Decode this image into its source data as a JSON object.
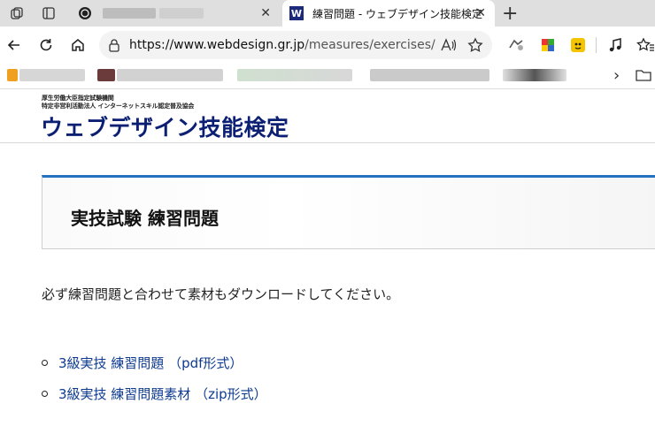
{
  "browser": {
    "tabs": [
      {
        "title": "",
        "active": false
      },
      {
        "title": "練習問題 - ウェブデザイン技能検定",
        "favicon": "W",
        "active": true
      }
    ],
    "new_tab": "+",
    "close_glyph": "✕",
    "url": {
      "prefix": "https://www.",
      "host": "webdesign.gr.jp",
      "path": "/measures/exercises/"
    },
    "bookmark_overflow": "›"
  },
  "site": {
    "ministry": "厚生労働大臣指定試験機関",
    "org": "特定非営利活動法人 インターネットスキル認定普及協会",
    "logo": "ウェブデザイン技能検定"
  },
  "page": {
    "heading": "実技試験 練習問題",
    "intro": "必ず練習問題と合わせて素材もダウンロードしてください。",
    "links": [
      {
        "label": "3級実技 練習問題 （pdf形式）"
      },
      {
        "label": "3級実技 練習問題素材 （zip形式）"
      }
    ]
  },
  "colors": {
    "accent": "#2371bf",
    "logo": "#0b1f73",
    "link": "#0d3a8f"
  }
}
